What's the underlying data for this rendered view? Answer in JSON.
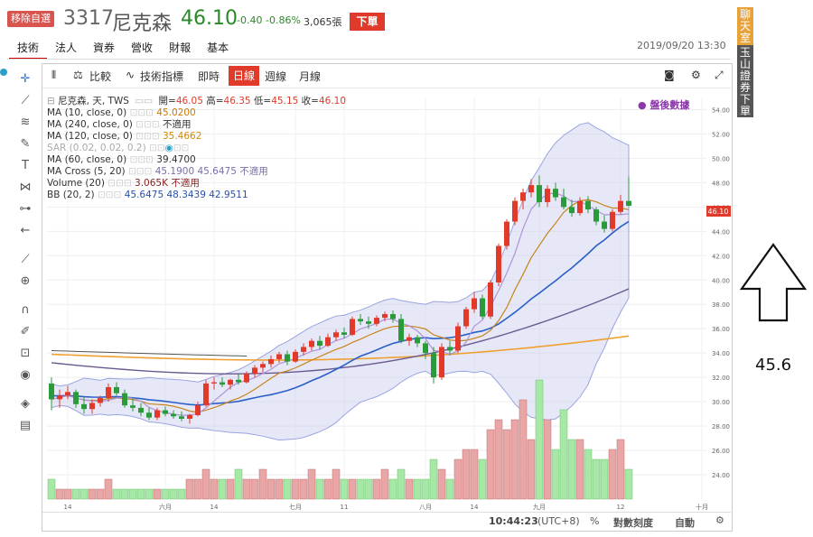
{
  "header": {
    "watch_label": "移除自選",
    "code": "3317",
    "name": "尼克森",
    "price": "46.10",
    "change": "-0.40",
    "change_pct": "-0.86%",
    "volume": "3,065張",
    "order_label": "下單",
    "datetime": "2019/09/20 13:30"
  },
  "nav": [
    "技術",
    "法人",
    "資券",
    "營收",
    "財報",
    "基本"
  ],
  "side": {
    "chat": "聊天室",
    "broker": "玉山證券下單",
    "annotation": "45.6"
  },
  "toolbar": {
    "compare": "比較",
    "indicators": "技術指標",
    "realtime": "即時",
    "daily": "日線",
    "weekly": "週線",
    "monthly": "月線"
  },
  "legend": {
    "title": "尼克森, 天, TWS",
    "ohlc": {
      "open_label": "開=",
      "open": "46.05",
      "high_label": "高=",
      "high": "46.35",
      "low_label": "低=",
      "low": "45.15",
      "close_label": "收=",
      "close": "46.10"
    },
    "indicators": [
      {
        "label": "MA (10, close, 0)",
        "value": "45.0200",
        "color": "#c87a00"
      },
      {
        "label": "MA (240, close, 0)",
        "value": "不適用",
        "color": "#333333"
      },
      {
        "label": "MA (120, close, 0)",
        "value": "35.4662",
        "color": "#d28a00"
      },
      {
        "label": "SAR (0.02, 0.02, 0.2)",
        "value": "",
        "color": "#aaaaaa"
      },
      {
        "label": "MA (60, close, 0)",
        "value": "39.4700",
        "color": "#333333"
      },
      {
        "label": "MA Cross (5, 20)",
        "value": "45.1900  45.6475  不適用",
        "color": "#7b6ea8"
      },
      {
        "label": "Volume (20)",
        "value": "3.065K  不適用",
        "color": "#8b2020"
      },
      {
        "label": "BB (20, 2)",
        "value": "45.6475  48.3439  42.9511",
        "color": "#2a4fa8"
      }
    ],
    "after_hours": "盤後數據"
  },
  "price_label": "46.10",
  "bottom": {
    "time": "10:44:23",
    "tz": "(UTC+8)",
    "pct": "%",
    "log": "對數刻度",
    "auto": "自動"
  },
  "chart_data": {
    "type": "candlestick",
    "y_axis": {
      "min": 22,
      "max": 55,
      "ticks": [
        "54.00",
        "52.00",
        "50.00",
        "48.00",
        "46.00",
        "44.00",
        "42.00",
        "40.00",
        "38.00",
        "36.00",
        "34.00",
        "32.00",
        "30.00",
        "28.00",
        "26.00",
        "24.00"
      ]
    },
    "x_labels": [
      "14",
      "六月",
      "14",
      "七月",
      "11",
      "八月",
      "14",
      "九月",
      "12",
      "十月"
    ],
    "candles": [
      [
        31.5,
        32.0,
        29.3,
        30.2
      ],
      [
        30.2,
        31.0,
        29.5,
        30.5
      ],
      [
        30.5,
        31.3,
        30.2,
        30.8
      ],
      [
        30.8,
        31.0,
        29.5,
        29.8
      ],
      [
        29.8,
        30.4,
        29.0,
        29.4
      ],
      [
        29.4,
        30.2,
        29.0,
        29.9
      ],
      [
        29.9,
        30.5,
        29.6,
        30.3
      ],
      [
        30.3,
        31.5,
        30.0,
        31.2
      ],
      [
        31.2,
        31.6,
        30.5,
        30.7
      ],
      [
        30.7,
        31.0,
        29.5,
        29.7
      ],
      [
        29.7,
        30.3,
        29.2,
        29.5
      ],
      [
        29.5,
        29.9,
        28.8,
        29.1
      ],
      [
        29.1,
        29.5,
        28.5,
        28.7
      ],
      [
        28.7,
        29.5,
        28.5,
        29.3
      ],
      [
        29.3,
        29.6,
        28.8,
        29.0
      ],
      [
        29.0,
        29.3,
        28.6,
        28.8
      ],
      [
        28.8,
        29.2,
        28.4,
        28.6
      ],
      [
        28.6,
        29.0,
        28.2,
        28.9
      ],
      [
        28.9,
        30.0,
        28.8,
        29.7
      ],
      [
        29.7,
        31.8,
        29.6,
        31.5
      ],
      [
        31.5,
        32.0,
        31.0,
        31.6
      ],
      [
        31.6,
        32.0,
        31.2,
        31.4
      ],
      [
        31.4,
        31.9,
        31.0,
        31.8
      ],
      [
        31.8,
        32.3,
        31.4,
        31.6
      ],
      [
        31.6,
        32.5,
        31.5,
        32.3
      ],
      [
        32.3,
        33.0,
        32.0,
        32.8
      ],
      [
        32.8,
        33.3,
        32.4,
        33.1
      ],
      [
        33.1,
        33.8,
        32.8,
        33.5
      ],
      [
        33.5,
        34.1,
        33.2,
        33.9
      ],
      [
        33.9,
        34.2,
        33.0,
        33.3
      ],
      [
        33.3,
        34.3,
        33.2,
        34.1
      ],
      [
        34.1,
        34.8,
        33.8,
        34.5
      ],
      [
        34.5,
        35.2,
        34.2,
        35.0
      ],
      [
        35.0,
        35.4,
        34.3,
        34.6
      ],
      [
        34.6,
        35.6,
        34.5,
        35.3
      ],
      [
        35.3,
        35.9,
        35.0,
        35.7
      ],
      [
        35.7,
        36.1,
        35.2,
        35.5
      ],
      [
        35.5,
        37.0,
        35.4,
        36.8
      ],
      [
        36.8,
        37.2,
        36.3,
        36.6
      ],
      [
        36.6,
        37.0,
        36.0,
        36.4
      ],
      [
        36.4,
        37.1,
        36.2,
        36.9
      ],
      [
        36.9,
        37.4,
        36.6,
        37.2
      ],
      [
        37.2,
        37.5,
        36.5,
        36.8
      ],
      [
        36.8,
        37.2,
        34.8,
        35.0
      ],
      [
        35.0,
        35.6,
        34.6,
        35.3
      ],
      [
        35.3,
        35.5,
        34.5,
        34.8
      ],
      [
        34.8,
        35.0,
        33.5,
        34.0
      ],
      [
        34.0,
        34.5,
        31.5,
        32.0
      ],
      [
        32.0,
        34.8,
        31.8,
        34.5
      ],
      [
        34.5,
        35.0,
        33.8,
        34.2
      ],
      [
        34.2,
        36.5,
        34.0,
        36.2
      ],
      [
        36.2,
        37.8,
        36.0,
        37.6
      ],
      [
        37.6,
        39.0,
        37.3,
        38.5
      ],
      [
        38.5,
        38.8,
        36.8,
        37.0
      ],
      [
        37.0,
        40.0,
        36.8,
        39.8
      ],
      [
        39.8,
        43.0,
        39.5,
        42.8
      ],
      [
        42.8,
        45.0,
        42.5,
        44.8
      ],
      [
        44.8,
        46.8,
        44.5,
        46.5
      ],
      [
        46.5,
        47.5,
        45.8,
        47.2
      ],
      [
        47.2,
        48.3,
        46.8,
        47.8
      ],
      [
        47.8,
        48.6,
        46.0,
        46.4
      ],
      [
        46.4,
        47.8,
        46.0,
        47.5
      ],
      [
        47.5,
        48.0,
        46.5,
        46.8
      ],
      [
        46.8,
        47.5,
        45.8,
        46.0
      ],
      [
        46.0,
        46.6,
        45.2,
        45.5
      ],
      [
        45.5,
        46.8,
        45.3,
        46.5
      ],
      [
        46.5,
        46.9,
        45.5,
        45.8
      ],
      [
        45.8,
        46.0,
        44.5,
        44.8
      ],
      [
        44.8,
        45.3,
        43.9,
        44.2
      ],
      [
        44.2,
        45.8,
        44.0,
        45.6
      ],
      [
        45.6,
        47.0,
        45.4,
        46.5
      ],
      [
        46.5,
        48.5,
        46.0,
        46.1
      ]
    ],
    "volume": [
      2,
      1,
      1,
      1,
      1,
      1,
      1,
      2,
      1,
      1,
      1,
      1,
      1,
      1,
      1,
      1,
      1,
      2,
      2,
      3,
      2,
      2,
      2,
      3,
      2,
      2,
      3,
      2,
      2,
      2,
      2,
      2,
      3,
      2,
      2,
      3,
      2,
      2,
      2,
      2,
      2,
      3,
      2,
      3,
      2,
      2,
      2,
      4,
      3,
      2,
      4,
      5,
      5,
      4,
      7,
      8,
      7,
      8,
      10,
      6,
      12,
      8,
      5,
      9,
      6,
      6,
      5,
      4,
      4,
      5,
      6,
      3
    ]
  }
}
